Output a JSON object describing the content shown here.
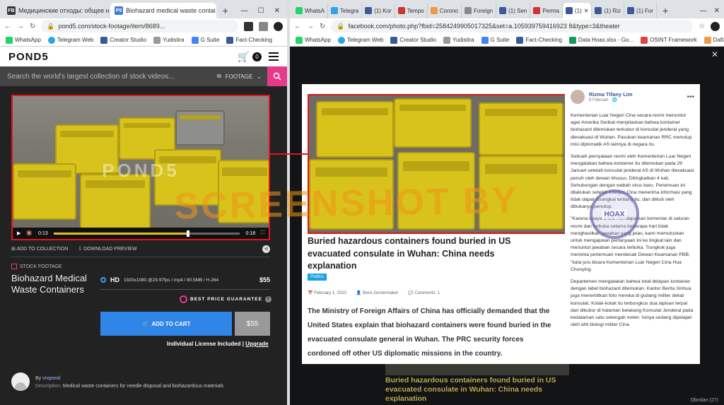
{
  "left_window": {
    "tabs": [
      {
        "label": "Медицинские отходы: общее н",
        "active": false,
        "favicon": "FB"
      },
      {
        "label": "Biohazard medical waste contai",
        "active": true,
        "favicon": "P5"
      }
    ],
    "url": "pond5.com/stock-footage/item/8689...",
    "bookmarks": [
      "WhatsApp",
      "Telegram Web",
      "Creator Studio",
      "Yudistira",
      "G Suite",
      "Fact-Checking"
    ]
  },
  "pond5": {
    "logo": "POND5",
    "cart_count": "0",
    "search": {
      "placeholder": "Search the world's largest collection of stock videos...",
      "category": "FOOTAGE"
    },
    "video": {
      "watermark": "POND5",
      "time_current": "0:13",
      "time_total": "0:18",
      "progress": 0.72
    },
    "actions": {
      "add_collection": "ADD TO COLLECTION",
      "download_preview": "DOWNLOAD PREVIEW"
    },
    "kicker": "STOCK FOOTAGE",
    "title": "Biohazard Medical Waste Containers",
    "spec": {
      "format": "HD",
      "details": "1920x1080 @29.97fps / mp4 / 80.5MB / H.264",
      "price": "$55"
    },
    "guarantee": "BEST PRICE GUARANTEE",
    "add_to_cart": "ADD TO CART",
    "price_button": "$55",
    "license": "Individual License Included",
    "upgrade": "Upgrade",
    "author_prefix": "By",
    "author": "vrxpond",
    "description_label": "Description:",
    "description": "Medical waste containers for needle disposal and biohazardous materials"
  },
  "right_window": {
    "tabs": [
      "WhatsA",
      "Telegra",
      "(1) Kor",
      "Tempo",
      "Corono",
      "Foreign",
      "(1) Sen",
      "Perma",
      "(1)",
      "(1) Riz",
      "(1) For"
    ],
    "url": "facebook.com/photo.php?fbid=2584249905017325&set=a.105939759416923 8&type=3&theater",
    "bookmarks": [
      "WhatsApp",
      "Telegram Web",
      "Creator Studio",
      "Yudistira",
      "G Suite",
      "Fact-Checking",
      "Data Hoax.xlsx - Go...",
      "OSINT Framework",
      "Daftar Fact-check..."
    ]
  },
  "facebook": {
    "headline": "Buried hazardous containers found buried in US evacuated consulate in Wuhan: China needs explanation",
    "tag": "Politics",
    "date": "February 1, 2020",
    "author": "Boris Gontermaker",
    "comments": "Comments: 1",
    "lede": "The Ministry of Foreign Affairs of China has officially demanded that the United States explain that biohazard containers were found buried in the evacuated consulate general in Wuhan. The PRC security forces cordoned off other US diplomatic missions in the country.",
    "poster_name": "Rizma Tifany Lim",
    "poster_date": "8 Februari",
    "paragraphs": [
      "Kementerian Luar Negeri Cina secara resmi menuntut agar Amerika Serikat menjelaskan bahwa kontainer biohazard ditemukan terkubur di konsulat jenderal yang dievakuasi di Wuhan. Pasukan keamanan RRC menutup misi diplomatik AS lainnya di negara itu.",
      "Sebuah pernyataan resmi oleh Kementerian Luar Negeri mengatakan bahwa kontainer itu ditemukan pada 29 Januari setelah konsulat jenderal AS di Wuhan dievakuasi penuh oleh dewan khusus. Ditingkatkan 4 kali, Sehubungan dengan wabah virus baru. Penemuan ini dilakukan setelah intelijen Cina menerima informasi yang tidak dapat disangkal tentang itu, dan diikuti oleh dibukanya penutup.",
      "\"Karena upaya untuk mendapatkan komentar di saluran resmi dan terbuka selama beberapa hari tidak menghasilkan jawaban yang jelas, kami memutuskan untuk mengajukan pertanyaan ini ke tingkat lain dan menuntut jawaban secara terbuka. Tiongkok juga meminta pertemuan mendesak Dewan Keamanan PBB, \"kata juru bicara Kementerian Luar Negeri Cina Hua Chunying.",
      "Departemen mengatakan bahwa total delapan kontainer dengan label biohazard ditemukan. Kantor Berita Xinhua juga menerbitkan foto mereka di gudang militer dekat konsulat. Kotak-kotak itu terbungkus dua lapisan terpal dan dikubur di halaman belakang Konsulat Jenderal pada kedalaman satu setengah meter. Isinya sedang dipelajari oleh ahli biologi militer Cina"
    ],
    "below_headline": "Buried hazardous containers found buried in US evacuated consulate in Wuhan: China needs explanation",
    "bottom_links": [
      "Obrolan (27)"
    ]
  },
  "overlay": {
    "stamp": "SCREENSHOT BY",
    "seal": "HOAX"
  }
}
